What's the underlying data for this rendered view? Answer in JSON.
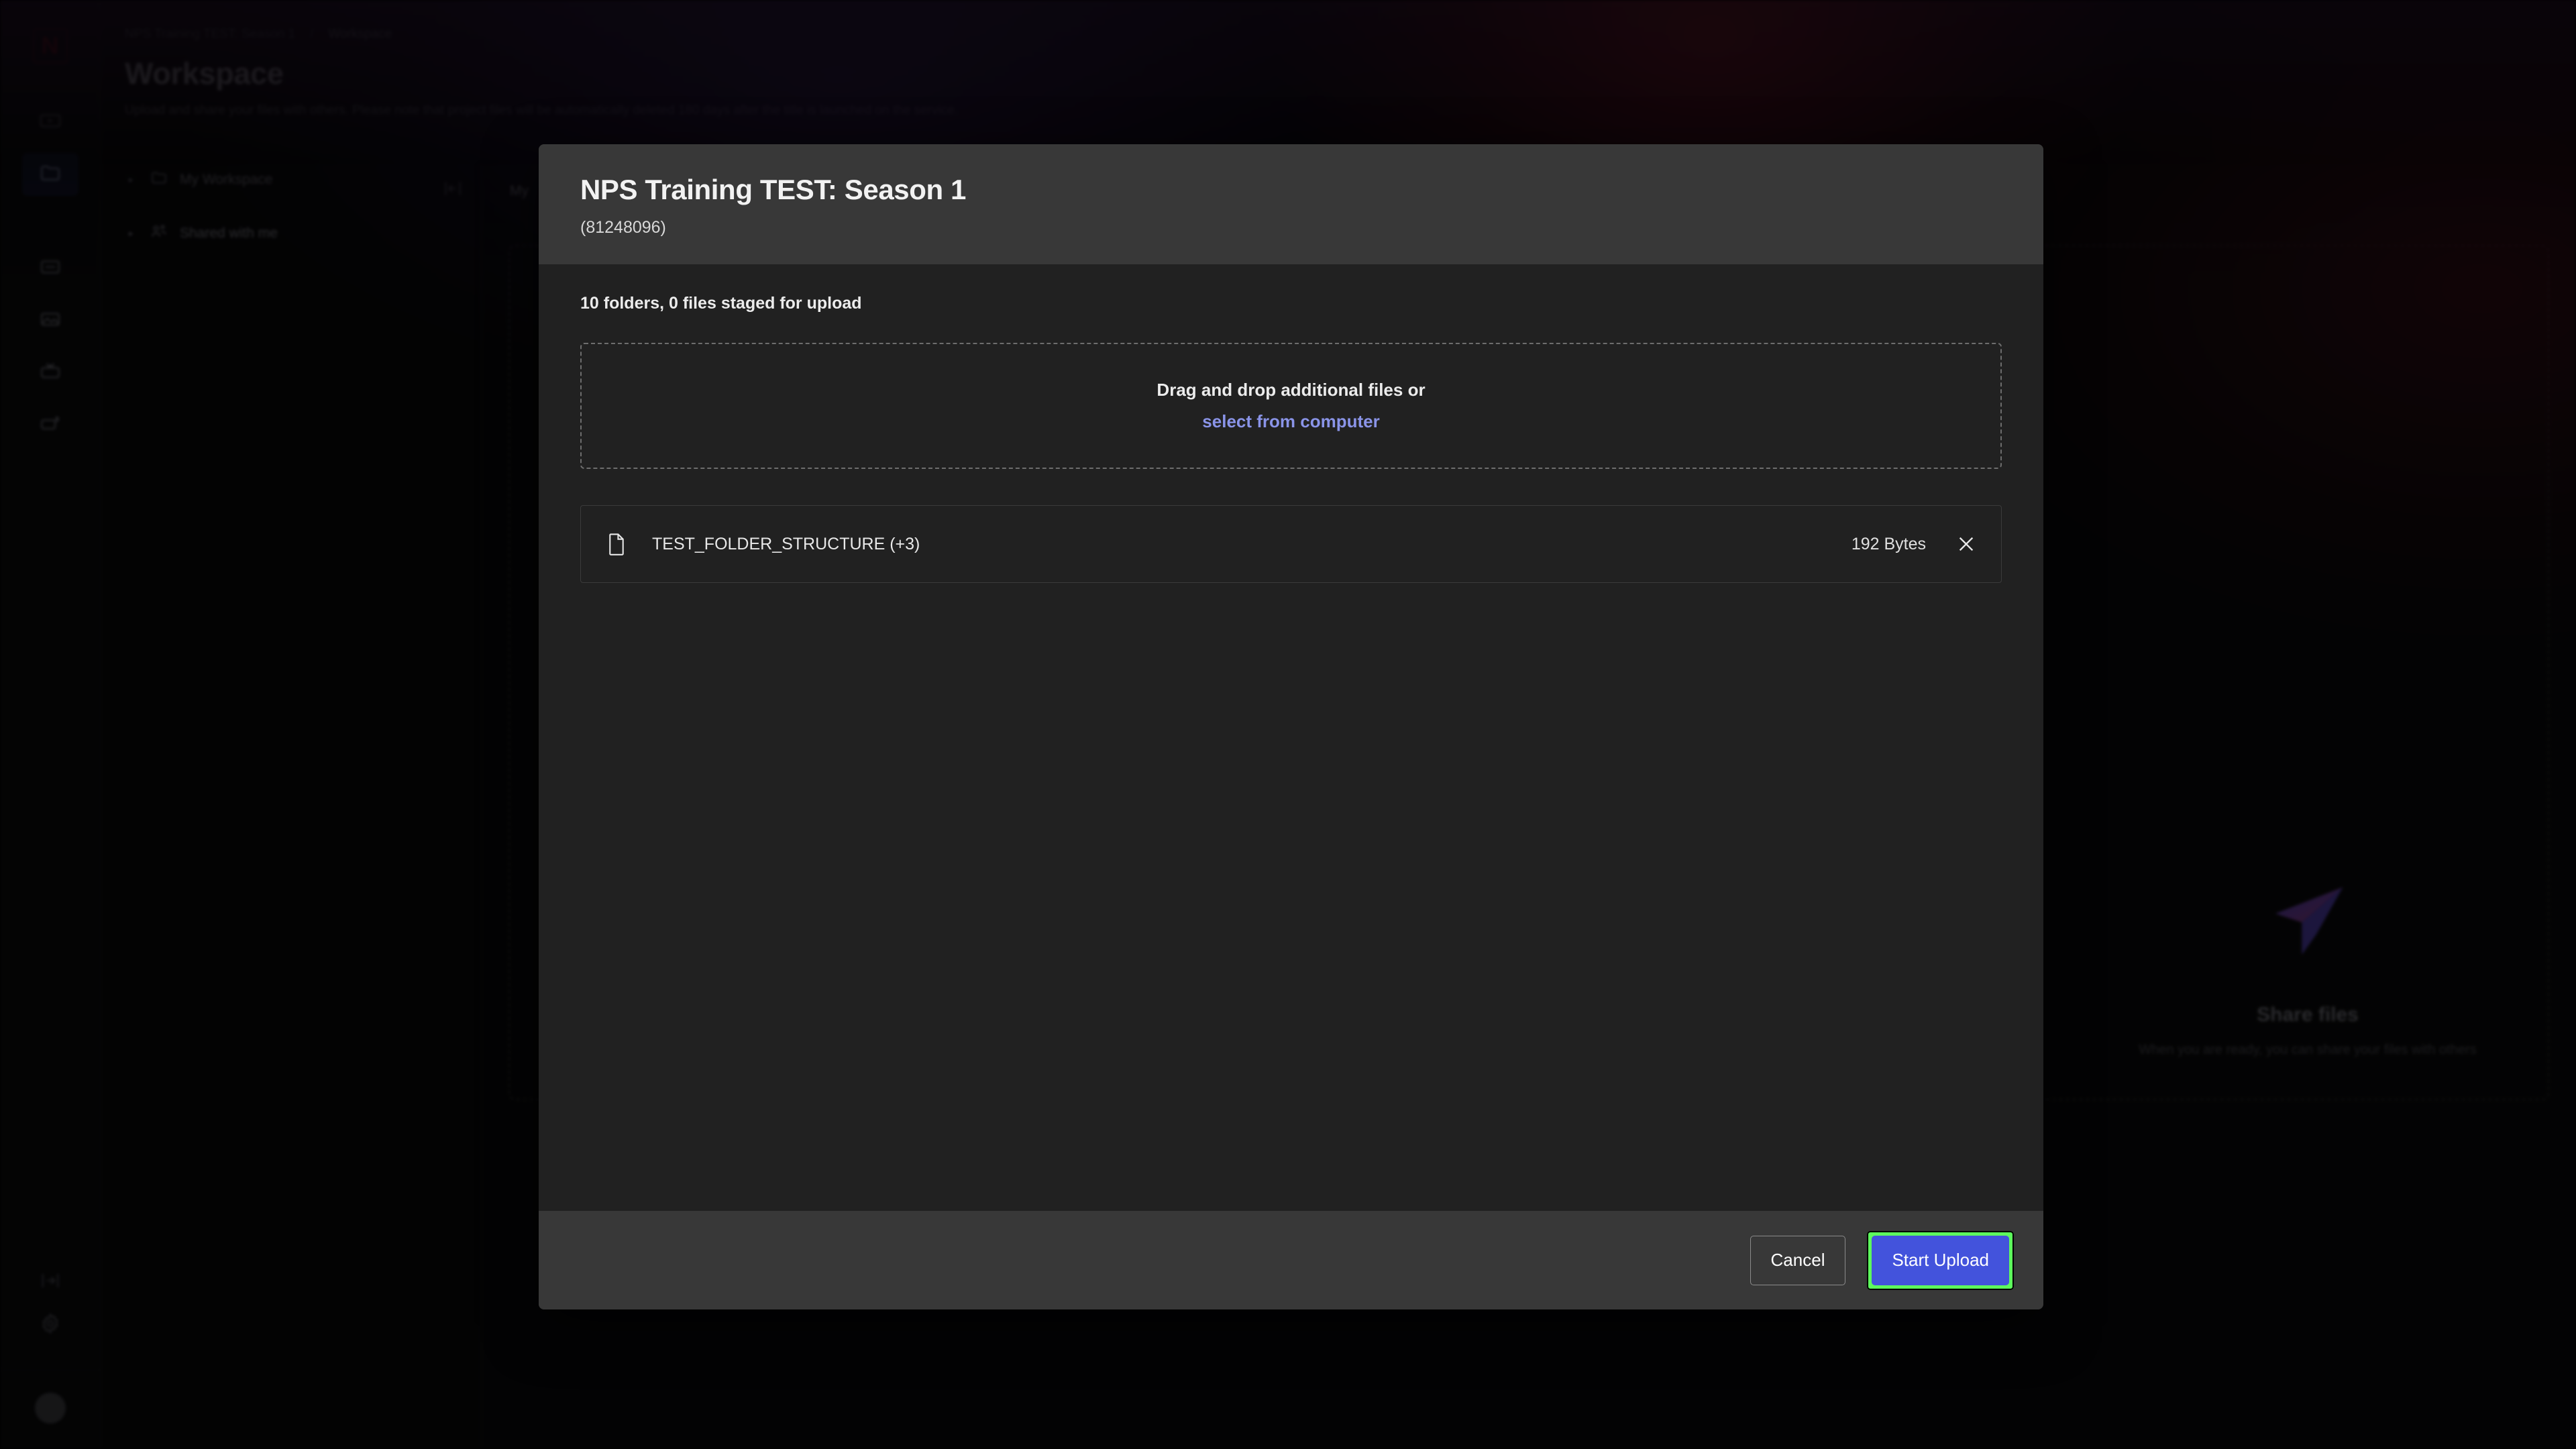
{
  "rail": {
    "logo": "N",
    "items": [
      {
        "name": "player-icon",
        "label": "Player"
      },
      {
        "name": "folder-icon",
        "label": "Workspace",
        "active": true
      },
      {
        "name": "card-icon",
        "label": "Cards"
      },
      {
        "name": "image-icon",
        "label": "Images"
      },
      {
        "name": "scissors-icon",
        "label": "Clips"
      },
      {
        "name": "export-icon",
        "label": "Exports"
      }
    ],
    "collapse_label": "Collapse rail",
    "gear_label": "Settings",
    "avatar_label": "Account"
  },
  "breadcrumb": {
    "project": "NPS Training TEST: Season 1",
    "separator": "/",
    "current": "Workspace"
  },
  "page": {
    "title": "Workspace",
    "subtitle": "Upload and share your files with others. Please note that project files will be automatically deleted 180 days after the title is launched on the service."
  },
  "tree": {
    "collapse_label": "Collapse panel",
    "items": [
      {
        "caret": "▸",
        "icon": "folder-icon",
        "label": "My Workspace"
      },
      {
        "caret": "▸",
        "icon": "shared-users-icon",
        "label": "Shared with me"
      }
    ]
  },
  "content": {
    "tab_label": "My",
    "share": {
      "title": "Share files",
      "subtitle": "When you are ready, you can share your files with others"
    }
  },
  "modal": {
    "title": "NPS Training TEST: Season 1",
    "subtitle": "(81248096)",
    "staged_summary": "10 folders, 0 files staged for upload",
    "dropzone": {
      "text": "Drag and drop additional files or",
      "link": "select from computer"
    },
    "files": [
      {
        "icon": "file-icon",
        "name": "TEST_FOLDER_STRUCTURE (+3)",
        "size": "192 Bytes",
        "remove_icon": "close-icon"
      }
    ],
    "footer": {
      "cancel_label": "Cancel",
      "start_upload_label": "Start Upload"
    }
  },
  "colors": {
    "accent_blue": "#4353dc",
    "link_blue": "#8a94e8",
    "highlight_green": "#5dfa5d",
    "brand_red": "#8b1218",
    "modal_header_bg": "#383838",
    "modal_body_bg": "#212121"
  }
}
